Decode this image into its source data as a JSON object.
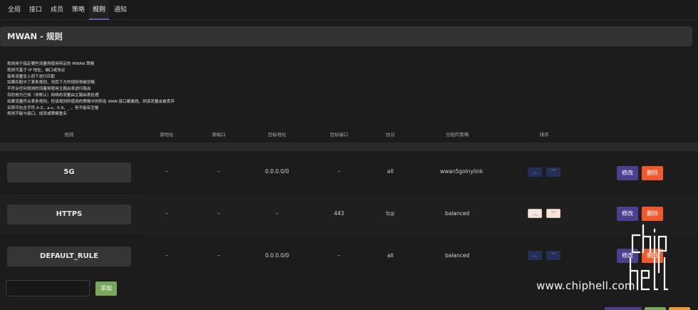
{
  "tabs": [
    {
      "label": "全局",
      "active": false
    },
    {
      "label": "接口",
      "active": false
    },
    {
      "label": "成员",
      "active": false
    },
    {
      "label": "策略",
      "active": false
    },
    {
      "label": "规则",
      "active": true
    },
    {
      "label": "通知",
      "active": false
    }
  ],
  "page_title": "MWAN - 规则",
  "description": [
    "规则用于指定哪些流量将使用特定的 MWAN 策略",
    "规则可基于 IP 地址，端口或协议",
    "每条流量至上而下进行匹配",
    "如果匹配中了某条规则，则其下方的规则将被忽略",
    "不符合任何规则的流量将使用主路由表进行路由",
    "目的地为已知（非默认）网络的流量由主路由表处理",
    "如果流量符合某条规则，但该规则所使用的策略中的所有 WAN 接口都离线，则该流量会被丢弃",
    "名称可包含字符 A-Z，a-z，0-9，_ ，但不能有空格",
    "规则不能与接口，成员或策略重名"
  ],
  "columns": [
    "规则",
    "源地址",
    "源端口",
    "目标地址",
    "目标端口",
    "协议",
    "分配的策略",
    "排序"
  ],
  "rules": [
    {
      "name": "5G",
      "src_ip": "–",
      "src_port": "–",
      "dest_ip": "0.0.0.0/0",
      "dest_port": "–",
      "proto": "all",
      "policy": "wwan5golnylink"
    },
    {
      "name": "HTTPS",
      "src_ip": "–",
      "src_port": "–",
      "dest_ip": "–",
      "dest_port": "443",
      "proto": "tcp",
      "policy": "balanced"
    },
    {
      "name": "DEFAULT_RULE",
      "src_ip": "–",
      "src_port": "–",
      "dest_ip": "0.0.0.0/0",
      "dest_port": "–",
      "proto": "all",
      "policy": "balanced"
    }
  ],
  "actions": {
    "edit": "修改",
    "delete": "删除",
    "add": "添加"
  },
  "icons": {
    "sort_up": "chevron-up-icon",
    "sort_down": "chevron-down-icon"
  },
  "watermark": {
    "text": "www.chiphell.com"
  },
  "colors": {
    "accent": "#5b63a8",
    "edit": "#4d3f8f",
    "delete": "#f0592e",
    "add": "#79a85a",
    "sort_active": "#f4e6dc"
  }
}
